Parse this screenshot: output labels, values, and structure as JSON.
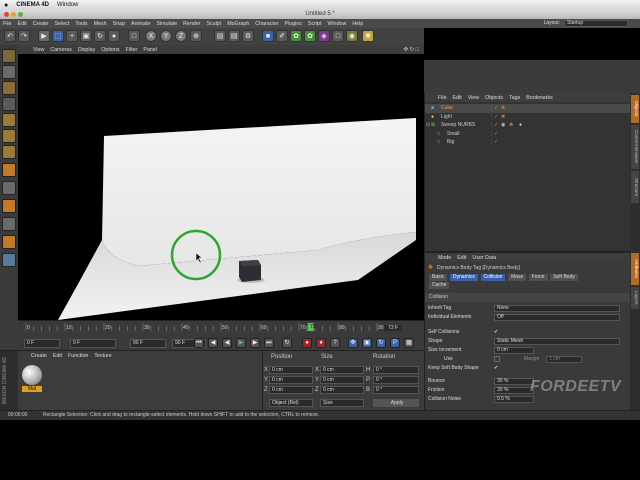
{
  "mac_menubar": {
    "apple": "",
    "app": "CINEMA 4D",
    "window": "Window"
  },
  "window_title": "Untitled 5 *",
  "menu": {
    "items": [
      "File",
      "Edit",
      "Create",
      "Select",
      "Tools",
      "Mesh",
      "Snap",
      "Animate",
      "Simulate",
      "Render",
      "Sculpt",
      "MoGraph",
      "Character",
      "Plugins",
      "Script",
      "Window",
      "Help"
    ],
    "layout_label": "Layout:",
    "layout_value": "Startup"
  },
  "viewport": {
    "menu": [
      "View",
      "Cameras",
      "Display",
      "Options",
      "Filter",
      "Panel"
    ]
  },
  "timeline": {
    "ticks": [
      "0",
      "10",
      "20",
      "30",
      "40",
      "50",
      "60",
      "70",
      "80",
      "90"
    ],
    "current_frame": "73",
    "end_label": "73 F"
  },
  "transport": {
    "start_field": "0 F",
    "current_field": "0 F",
    "end_field": "90 F",
    "max_field": "90 F"
  },
  "material_manager": {
    "menu": [
      "Create",
      "Edit",
      "Function",
      "Texture"
    ],
    "material_name": "Mat"
  },
  "coordinates": {
    "headers": [
      "Position",
      "Size",
      "Rotation"
    ],
    "rows": [
      {
        "axis": "X",
        "pos": "0 cm",
        "size_axis": "X",
        "size": "0 cm",
        "rot_axis": "H",
        "rot": "0 °"
      },
      {
        "axis": "Y",
        "pos": "0 cm",
        "size_axis": "Y",
        "size": "0 cm",
        "rot_axis": "P",
        "rot": "0 °"
      },
      {
        "axis": "Z",
        "pos": "0 cm",
        "size_axis": "Z",
        "size": "0 cm",
        "rot_axis": "B",
        "rot": "0 °"
      }
    ],
    "mode": "Object (Rel)",
    "size_mode": "Size",
    "apply": "Apply"
  },
  "status_bar": {
    "time": "00:00:00",
    "message": "Rectangle Selection: Click and drag to rectangle-select elements. Hold down SHIFT to add to the selection, CTRL to remove."
  },
  "object_manager": {
    "menu": [
      "File",
      "Edit",
      "View",
      "Objects",
      "Tags",
      "Bookmarks"
    ],
    "objects": [
      {
        "name": "Cube",
        "selected": true,
        "indent": 0
      },
      {
        "name": "Light",
        "selected": false,
        "indent": 0
      },
      {
        "name": "Sweep NURBS",
        "selected": false,
        "indent": 0
      },
      {
        "name": "Small",
        "selected": false,
        "indent": 1
      },
      {
        "name": "Big",
        "selected": false,
        "indent": 1
      }
    ]
  },
  "attribute_manager": {
    "menu": [
      "Mode",
      "Edit",
      "User Data"
    ],
    "title": "Dynamics Body Tag [Dynamics Body]",
    "tabs": [
      "Basic",
      "Dynamics",
      "Collision",
      "Mass",
      "Force",
      "Soft Body"
    ],
    "tab_row2": [
      "Cache"
    ],
    "active_tab": "Collision",
    "section": "Collision",
    "fields": [
      {
        "label": "Inherit Tag",
        "value": "None"
      },
      {
        "label": "Individual Elements",
        "value": "Off"
      },
      {
        "label": "Self Collisions",
        "value": "✔"
      },
      {
        "label": "Shape",
        "value": "Static Mesh"
      },
      {
        "label": "Size Increment",
        "value": "0 cm"
      },
      {
        "label": "Use",
        "value": "",
        "extra_label": "Margin",
        "extra_value": "1 cm"
      },
      {
        "label": "Keep Soft Body Shape",
        "value": "✔"
      },
      {
        "label": "Bounce",
        "value": "30 %"
      },
      {
        "label": "Friction",
        "value": "30 %"
      },
      {
        "label": "Collision Noise",
        "value": "0.5 %"
      }
    ]
  },
  "side_tabs": [
    "Objects",
    "Content Browser",
    "Structure",
    "Attributes",
    "Layers"
  ],
  "watermark": "FORDEETV",
  "brand_side": "MAXON CINEMA 4D",
  "colors": {
    "accent_blue": "#3b5ea8",
    "selection_ring": "#2fa52f",
    "active_frame": "#5fbf5f"
  }
}
